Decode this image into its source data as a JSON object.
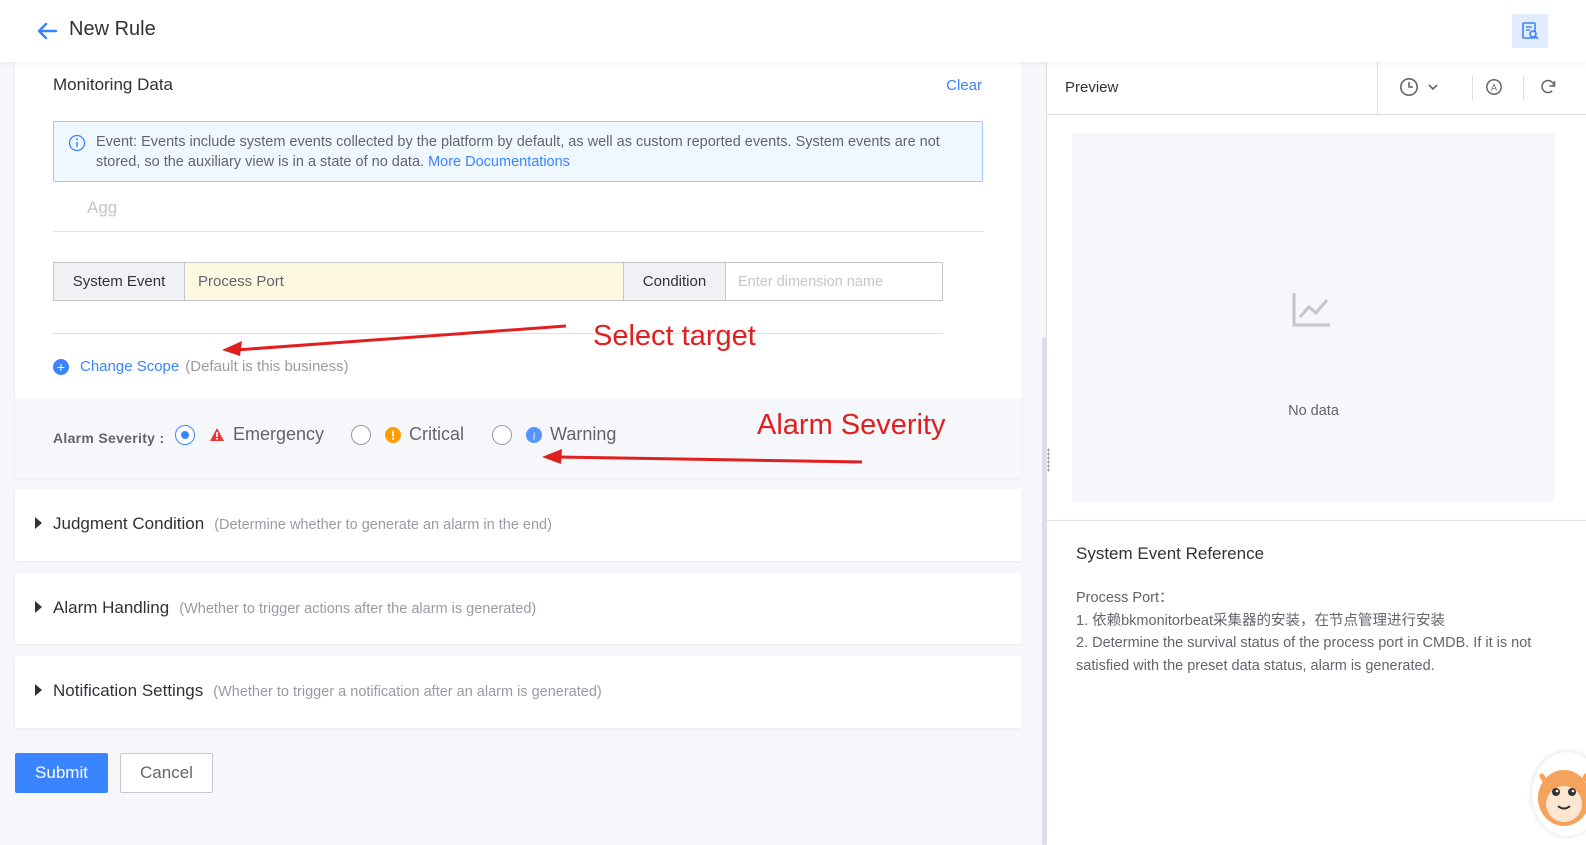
{
  "header": {
    "title": "New Rule"
  },
  "monitoring": {
    "title": "Monitoring Data",
    "clear_label": "Clear",
    "info_text": "Event: Events include system events collected by the platform by default, as well as custom reported events. System events are not stored, so the auxiliary view is in a state of no data.",
    "info_link": "More Documentations",
    "agg_placeholder": "Agg",
    "event_type_label": "System Event",
    "event_value": "Process Port",
    "condition_label": "Condition",
    "dimension_placeholder": "Enter dimension name",
    "change_scope_label": "Change Scope",
    "change_scope_hint": "(Default is this business)"
  },
  "severity": {
    "label": "Alarm Severity :",
    "options": [
      {
        "label": "Emergency",
        "checked": true,
        "color": "#ea3636"
      },
      {
        "label": "Critical",
        "checked": false,
        "color": "#ff9c01"
      },
      {
        "label": "Warning",
        "checked": false,
        "color": "#3a84ff"
      }
    ]
  },
  "annotations": {
    "select_target": "Select target",
    "alarm_severity": "Alarm Severity",
    "color": "#e02020"
  },
  "sections": [
    {
      "title": "Judgment Condition",
      "hint": "(Determine whether to generate an alarm in the end)"
    },
    {
      "title": "Alarm Handling",
      "hint": "(Whether to trigger actions after the alarm is generated)"
    },
    {
      "title": "Notification Settings",
      "hint": "(Whether to trigger a notification after an alarm is generated)"
    }
  ],
  "actions": {
    "submit_label": "Submit",
    "cancel_label": "Cancel"
  },
  "preview": {
    "title": "Preview",
    "no_data": "No data",
    "reference_title": "System Event Reference",
    "reference_heading": "Process Port：",
    "reference_lines": [
      "1. 依赖bkmonitorbeat采集器的安装，在节点管理进行安装",
      "2. Determine the survival status of the process port in CMDB. If it is not satisfied with the preset data status, alarm is generated."
    ]
  },
  "colors": {
    "primary": "#3a84ff",
    "danger": "#ea3636",
    "warning": "#ff9c01"
  }
}
